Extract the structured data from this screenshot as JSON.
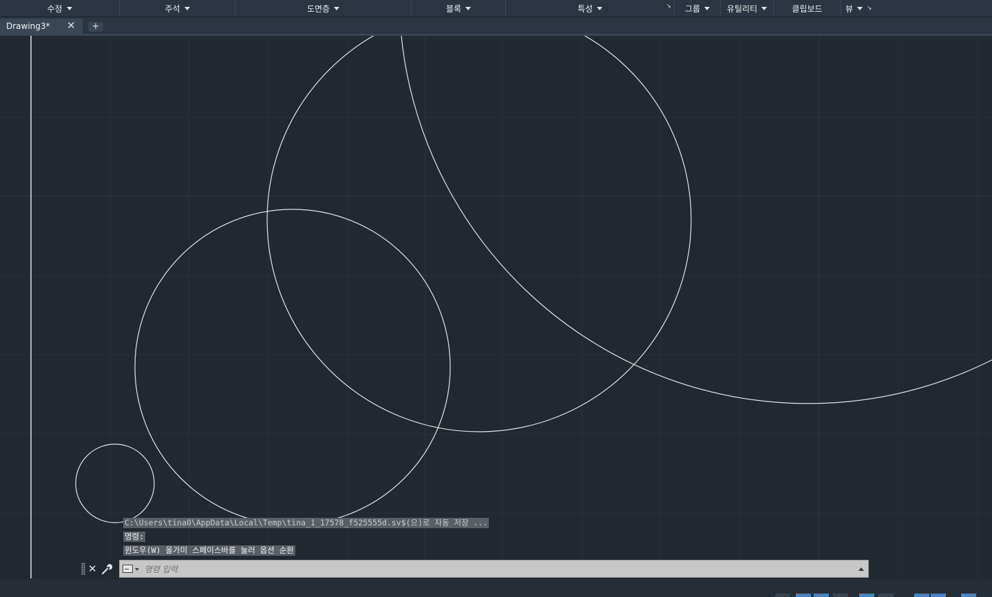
{
  "ribbon": {
    "panels": [
      {
        "label": "수정",
        "dropdown": true
      },
      {
        "label": "주석",
        "dropdown": true
      },
      {
        "label": "도면층",
        "dropdown": true
      },
      {
        "label": "블록",
        "dropdown": true
      },
      {
        "label": "특성",
        "dropdown": true
      },
      {
        "label": "그룹",
        "dropdown": true
      },
      {
        "label": "유틸리티",
        "dropdown": true
      },
      {
        "label": "클립보드",
        "dropdown": false
      },
      {
        "label": "뷰",
        "dropdown": true
      }
    ]
  },
  "tabs": {
    "active": "Drawing3*",
    "close_icon": "close-icon",
    "add_icon": "plus-icon"
  },
  "command": {
    "history": [
      "C:\\Users\\tina0\\AppData\\Local\\Temp\\tina_1_17578_f525555d.sv$(으)로 자동 저장 ...",
      "명령:",
      "윈도우(W) 올가미  스페이스바를 눌러 옵션 순환"
    ],
    "placeholder": "명령 입력",
    "close_icon": "close-icon",
    "customize_icon": "wrench-icon",
    "recent_icon": "prompt-icon",
    "history_icon": "chevron-up-icon"
  },
  "colors": {
    "canvas": "#212830",
    "ribbon": "#2b3440",
    "geometry": "#e6e6e6",
    "grid": "#2a323c",
    "status_active": "#4f83bd"
  }
}
